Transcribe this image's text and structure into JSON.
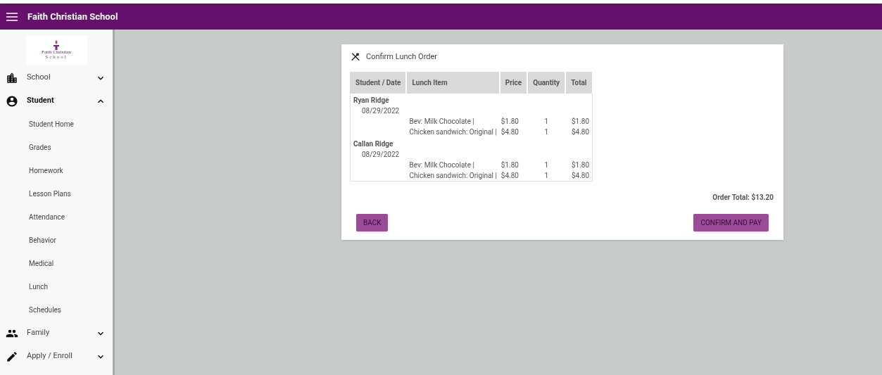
{
  "app_bar": {
    "title": "Faith Christian School"
  },
  "logo": {
    "name": "Faith Christian",
    "subtitle": "School"
  },
  "sidebar": {
    "items": [
      {
        "label": "School",
        "kind": "building",
        "expanded": false
      },
      {
        "label": "Student",
        "kind": "account",
        "expanded": true,
        "children": [
          {
            "label": "Student Home"
          },
          {
            "label": "Grades"
          },
          {
            "label": "Homework"
          },
          {
            "label": "Lesson Plans"
          },
          {
            "label": "Attendance"
          },
          {
            "label": "Behavior"
          },
          {
            "label": "Medical"
          },
          {
            "label": "Lunch"
          },
          {
            "label": "Schedules"
          }
        ]
      },
      {
        "label": "Family",
        "kind": "people",
        "expanded": false
      },
      {
        "label": "Apply / Enroll",
        "kind": "pencil",
        "expanded": false
      }
    ]
  },
  "card": {
    "title": "Confirm Lunch Order",
    "table": {
      "columns": [
        "Student / Date",
        "Lunch Item",
        "Price",
        "Quantity",
        "Total"
      ],
      "students": [
        {
          "name": "Ryan Ridge",
          "date": "08/29/2022",
          "items": [
            {
              "item": "Bev: Milk Chocolate |",
              "price": "$1.80",
              "quantity": "1",
              "total": "$1.80"
            },
            {
              "item": "Chicken sandwich: Original |",
              "price": "$4.80",
              "quantity": "1",
              "total": "$4.80"
            }
          ]
        },
        {
          "name": "Callan Ridge",
          "date": "08/29/2022",
          "items": [
            {
              "item": "Bev: Milk Chocolate |",
              "price": "$1.80",
              "quantity": "1",
              "total": "$1.80"
            },
            {
              "item": "Chicken sandwich: Original |",
              "price": "$4.80",
              "quantity": "1",
              "total": "$4.80"
            }
          ]
        }
      ]
    },
    "order_total": "Order Total: $13.20",
    "buttons": {
      "back": "BACK",
      "confirm": "CONFIRM AND PAY"
    }
  }
}
